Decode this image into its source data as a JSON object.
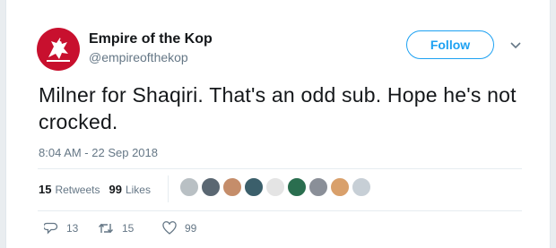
{
  "account": {
    "name": "Empire of the Kop",
    "handle": "@empireofthekop",
    "avatar_icon": "liverbird-logo-icon",
    "brand_color": "#c8102e"
  },
  "follow_label": "Follow",
  "tweet": {
    "text": "Milner for Shaqiri. That's an odd sub. Hope he's not crocked.",
    "timestamp": "8:04 AM - 22 Sep 2018"
  },
  "stats": {
    "retweets_count": "15",
    "retweets_label": "Retweets",
    "likes_count": "99",
    "likes_label": "Likes"
  },
  "likers": [
    {
      "color": "#b9c0c4"
    },
    {
      "color": "#5a6772"
    },
    {
      "color": "#c58d6a"
    },
    {
      "color": "#3b5f6b"
    },
    {
      "color": "#e4e4e4"
    },
    {
      "color": "#2a6e4f"
    },
    {
      "color": "#8a8f98"
    },
    {
      "color": "#d9a06b"
    },
    {
      "color": "#c7cfd6"
    }
  ],
  "actions": {
    "reply_count": "13",
    "retweet_count": "15",
    "like_count": "99"
  },
  "colors": {
    "accent": "#1da1f2",
    "muted": "#657786"
  }
}
